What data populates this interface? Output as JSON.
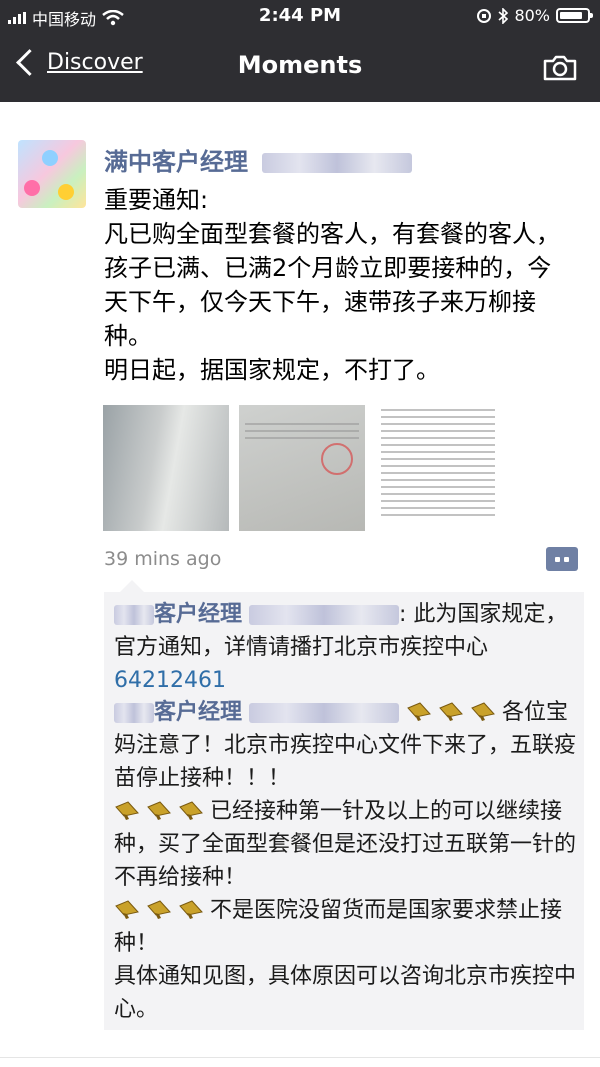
{
  "status_bar": {
    "carrier": "中国移动",
    "time": "2:44 PM",
    "battery": "80%"
  },
  "nav": {
    "back_label": "Discover",
    "title": "Moments",
    "camera_icon": "camera-icon"
  },
  "post": {
    "author_name": "满中客户经理",
    "text": "重要通知:\n凡已购全面型套餐的客人，有套餐的客人，孩子已满、已满2个月龄立即要接种的，今天下午，仅今天下午，速带孩子来万柳接种。\n明日起，据国家规定，不打了。",
    "time_ago": "39 mins ago",
    "photos": [
      "photo-1",
      "photo-2",
      "photo-3"
    ]
  },
  "comments": [
    {
      "author": "客户经理",
      "text": ": 此为国家规定，官方通知，详情请播打北京市疾控中心",
      "phone": "64212461"
    },
    {
      "author": "客户经理",
      "line1": "各位宝妈注意了！北京市疾控中心文件下来了，五联疫苗停止接种！！！",
      "line2": "已经接种第一针及以上的可以继续接种，买了全面型套餐但是还没打过五联第一针的不再给接种！",
      "line3": "不是医院没留货而是国家要求禁止接种！",
      "line4": "具体通知见图，具体原因可以咨询北京市疾控中心。"
    }
  ],
  "colors": {
    "bar_bg": "#2e2e32",
    "name_link": "#576b95",
    "phone_link": "#2f6ea8",
    "comment_bg": "#f3f3f5"
  }
}
